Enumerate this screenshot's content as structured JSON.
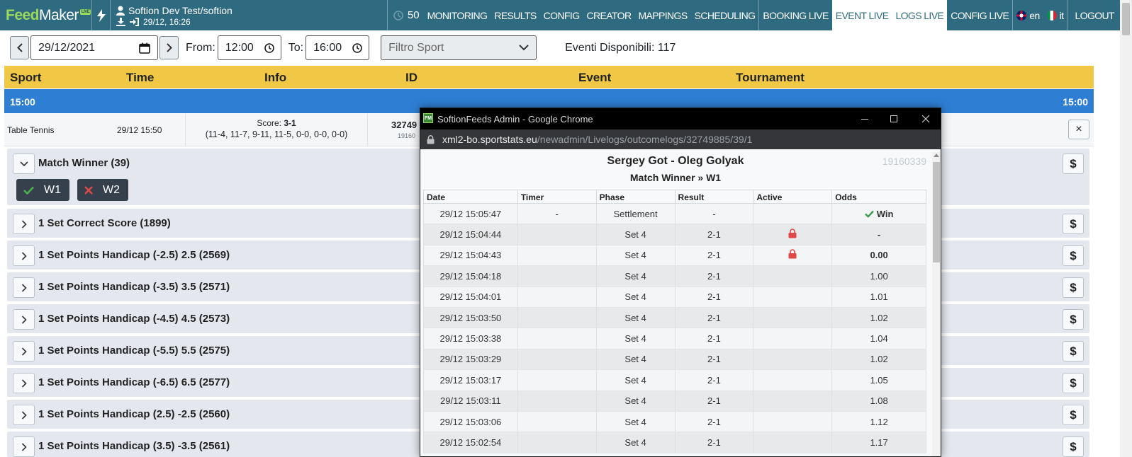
{
  "nav": {
    "logo_feed": "Feed",
    "logo_maker": "Maker",
    "logo_live": "LIVE",
    "user": "Softion Dev Test/softion",
    "session_time": "29/12, 16:26",
    "counter": "50",
    "items": [
      "MONITORING",
      "RESULTS",
      "CONFIG",
      "CREATOR",
      "MAPPINGS",
      "SCHEDULING"
    ],
    "live_items": [
      "BOOKING LIVE",
      "EVENT LIVE",
      "LOGS LIVE",
      "CONFIG LIVE"
    ],
    "lang_en": "en",
    "lang_it": "it",
    "logout": "LOGOUT"
  },
  "filters": {
    "date": "29/12/2021",
    "from_label": "From:",
    "from_time": "12:00",
    "to_label": "To:",
    "to_time": "16:00",
    "sport_placeholder": "Filtro Sport",
    "eventi_label": "Eventi Disponibili: 117"
  },
  "table": {
    "headers": [
      "Sport",
      "Time",
      "Info",
      "ID",
      "Event",
      "Tournament"
    ],
    "group_time": "15:00"
  },
  "event": {
    "sport": "Table Tennis",
    "time": "29/12 15:50",
    "score_label": "Score:",
    "score": "3-1",
    "sets": "(11-4, 11-7, 9-11, 11-5, 0-0, 0-0, 0-0)",
    "id": "32749",
    "subid": "19160",
    "close": "×"
  },
  "markets": [
    {
      "name": "Match Winner (39)",
      "expanded": true,
      "outcomes": [
        {
          "label": "W1",
          "status": "win"
        },
        {
          "label": "W2",
          "status": "lose"
        }
      ]
    },
    {
      "name": "1 Set Correct Score (1899)",
      "expanded": false
    },
    {
      "name": "1 Set Points Handicap (-2.5) 2.5 (2569)",
      "expanded": false
    },
    {
      "name": "1 Set Points Handicap (-3.5) 3.5 (2571)",
      "expanded": false
    },
    {
      "name": "1 Set Points Handicap (-4.5) 4.5 (2573)",
      "expanded": false
    },
    {
      "name": "1 Set Points Handicap (-5.5) 5.5 (2575)",
      "expanded": false
    },
    {
      "name": "1 Set Points Handicap (-6.5) 6.5 (2577)",
      "expanded": false
    },
    {
      "name": "1 Set Points Handicap (2.5) -2.5 (2560)",
      "expanded": false
    },
    {
      "name": "1 Set Points Handicap (3.5) -3.5 (2561)",
      "expanded": false
    }
  ],
  "popup": {
    "window_title": "SoftionFeeds Admin - Google Chrome",
    "url_host": "xml2-bo.sportstats.eu",
    "url_path": "/newadmin/Livelogs/outcomelogs/32749885/39/1",
    "match": "Sergey Got - Oleg Golyak",
    "market": "Match Winner » W1",
    "ref_id": "19160339",
    "columns": [
      "Date",
      "Timer",
      "Phase",
      "Result",
      "Active",
      "Odds"
    ],
    "rows": [
      {
        "date": "29/12 15:05:47",
        "timer": "-",
        "phase": "Settlement",
        "result": "-",
        "locked": false,
        "odds": "Win",
        "odds_style": "win"
      },
      {
        "date": "29/12 15:04:44",
        "timer": "",
        "phase": "Set 4",
        "result": "2-1",
        "locked": true,
        "odds": "-",
        "odds_style": "red"
      },
      {
        "date": "29/12 15:04:43",
        "timer": "",
        "phase": "Set 4",
        "result": "2-1",
        "locked": true,
        "odds": "0.00",
        "odds_style": "red"
      },
      {
        "date": "29/12 15:04:18",
        "timer": "",
        "phase": "Set 4",
        "result": "2-1",
        "locked": false,
        "odds": "1.00",
        "odds_style": ""
      },
      {
        "date": "29/12 15:04:01",
        "timer": "",
        "phase": "Set 4",
        "result": "2-1",
        "locked": false,
        "odds": "1.01",
        "odds_style": ""
      },
      {
        "date": "29/12 15:03:50",
        "timer": "",
        "phase": "Set 4",
        "result": "2-1",
        "locked": false,
        "odds": "1.02",
        "odds_style": ""
      },
      {
        "date": "29/12 15:03:38",
        "timer": "",
        "phase": "Set 4",
        "result": "2-1",
        "locked": false,
        "odds": "1.04",
        "odds_style": ""
      },
      {
        "date": "29/12 15:03:29",
        "timer": "",
        "phase": "Set 4",
        "result": "2-1",
        "locked": false,
        "odds": "1.02",
        "odds_style": ""
      },
      {
        "date": "29/12 15:03:17",
        "timer": "",
        "phase": "Set 4",
        "result": "2-1",
        "locked": false,
        "odds": "1.05",
        "odds_style": ""
      },
      {
        "date": "29/12 15:03:11",
        "timer": "",
        "phase": "Set 4",
        "result": "2-1",
        "locked": false,
        "odds": "1.08",
        "odds_style": ""
      },
      {
        "date": "29/12 15:03:06",
        "timer": "",
        "phase": "Set 4",
        "result": "2-1",
        "locked": false,
        "odds": "1.12",
        "odds_style": ""
      },
      {
        "date": "29/12 15:02:54",
        "timer": "",
        "phase": "Set 4",
        "result": "2-1",
        "locked": false,
        "odds": "1.17",
        "odds_style": ""
      }
    ]
  },
  "colors": {
    "navbar": "#2f6b80",
    "header_yellow": "#f0c846",
    "time_bar_blue": "#2e7fd3",
    "outcome_dark": "#35404c",
    "win_green": "#3d9a4a",
    "lose_red": "#e04848"
  }
}
